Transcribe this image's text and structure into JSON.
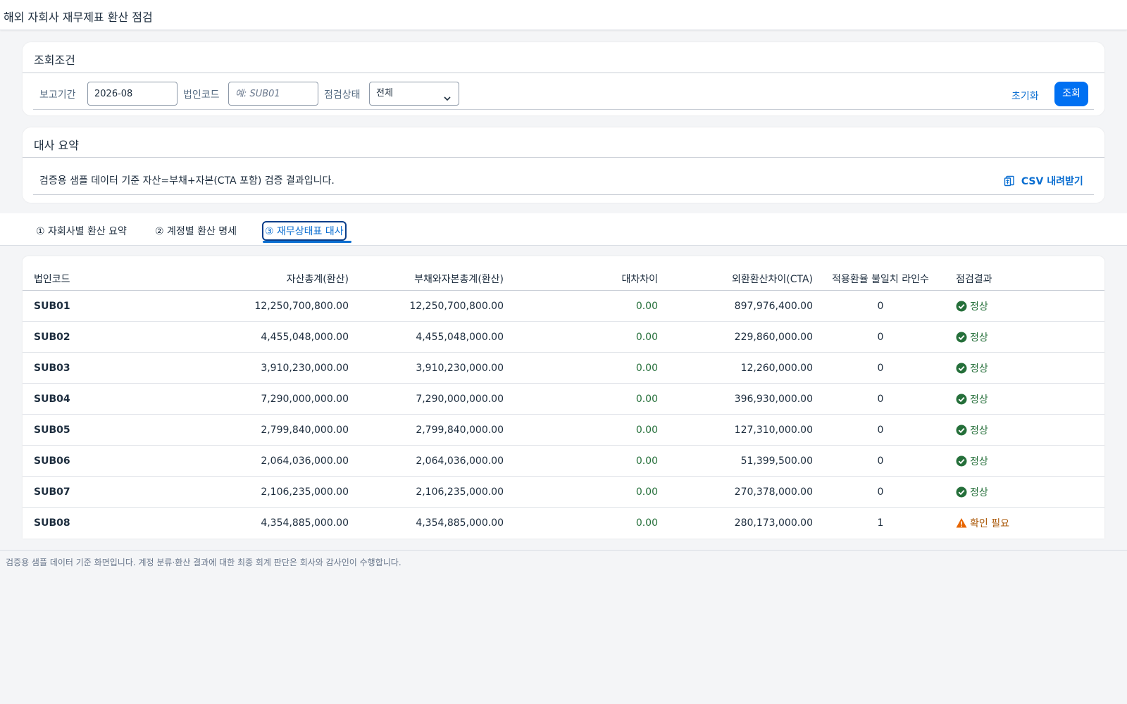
{
  "app": {
    "title": "해외 자회사 재무제표 환산 점검"
  },
  "filter": {
    "title": "조회조건",
    "period_label": "보고기간",
    "period_value": "2026-08",
    "entity_label": "법인코드",
    "entity_placeholder": "예: SUB01",
    "status_label": "점검상태",
    "status_value": "전체",
    "reset_label": "초기화",
    "search_label": "조회"
  },
  "summary": {
    "title": "대사 요약",
    "text": "검증용 샘플 데이터 기준 자산=부채+자본(CTA 포함) 검증 결과입니다.",
    "csv_label": "CSV 내려받기"
  },
  "tabs": [
    {
      "label": "① 자회사별 환산 요약"
    },
    {
      "label": "② 계정별 환산 명세"
    },
    {
      "label": "③ 재무상태표 대사"
    }
  ],
  "table": {
    "headers": [
      "법인코드",
      "자산총계(환산)",
      "부채와자본총계(환산)",
      "대차차이",
      "외환환산차이(CTA)",
      "적용환율 불일치 라인수",
      "점검결과"
    ],
    "rows": [
      {
        "code": "SUB01",
        "assets": "12,250,700,800.00",
        "liab_equity": "12,250,700,800.00",
        "diff": "0.00",
        "cta": "897,976,400.00",
        "mismatch": "0",
        "result": "정상",
        "status": "ok"
      },
      {
        "code": "SUB02",
        "assets": "4,455,048,000.00",
        "liab_equity": "4,455,048,000.00",
        "diff": "0.00",
        "cta": "229,860,000.00",
        "mismatch": "0",
        "result": "정상",
        "status": "ok"
      },
      {
        "code": "SUB03",
        "assets": "3,910,230,000.00",
        "liab_equity": "3,910,230,000.00",
        "diff": "0.00",
        "cta": "12,260,000.00",
        "mismatch": "0",
        "result": "정상",
        "status": "ok"
      },
      {
        "code": "SUB04",
        "assets": "7,290,000,000.00",
        "liab_equity": "7,290,000,000.00",
        "diff": "0.00",
        "cta": "396,930,000.00",
        "mismatch": "0",
        "result": "정상",
        "status": "ok"
      },
      {
        "code": "SUB05",
        "assets": "2,799,840,000.00",
        "liab_equity": "2,799,840,000.00",
        "diff": "0.00",
        "cta": "127,310,000.00",
        "mismatch": "0",
        "result": "정상",
        "status": "ok"
      },
      {
        "code": "SUB06",
        "assets": "2,064,036,000.00",
        "liab_equity": "2,064,036,000.00",
        "diff": "0.00",
        "cta": "51,399,500.00",
        "mismatch": "0",
        "result": "정상",
        "status": "ok"
      },
      {
        "code": "SUB07",
        "assets": "2,106,235,000.00",
        "liab_equity": "2,106,235,000.00",
        "diff": "0.00",
        "cta": "270,378,000.00",
        "mismatch": "0",
        "result": "정상",
        "status": "ok"
      },
      {
        "code": "SUB08",
        "assets": "4,354,885,000.00",
        "liab_equity": "4,354,885,000.00",
        "diff": "0.00",
        "cta": "280,173,000.00",
        "mismatch": "1",
        "result": "확인 필요",
        "status": "warn"
      }
    ]
  },
  "footer": {
    "note": "검증용 샘플 데이터 기준 화면입니다. 계정 분류·환산 결과에 대한 최종 회계 판단은 회사와 감사인이 수행합니다."
  },
  "colors": {
    "accent": "#0070f2",
    "link": "#0a6ed1",
    "ok": "#256f3a",
    "warn": "#e76500"
  },
  "icons": {
    "ok": "check-circle-icon",
    "warn": "warning-triangle-icon",
    "csv": "spreadsheet-icon",
    "select": "chevron-down-icon"
  }
}
